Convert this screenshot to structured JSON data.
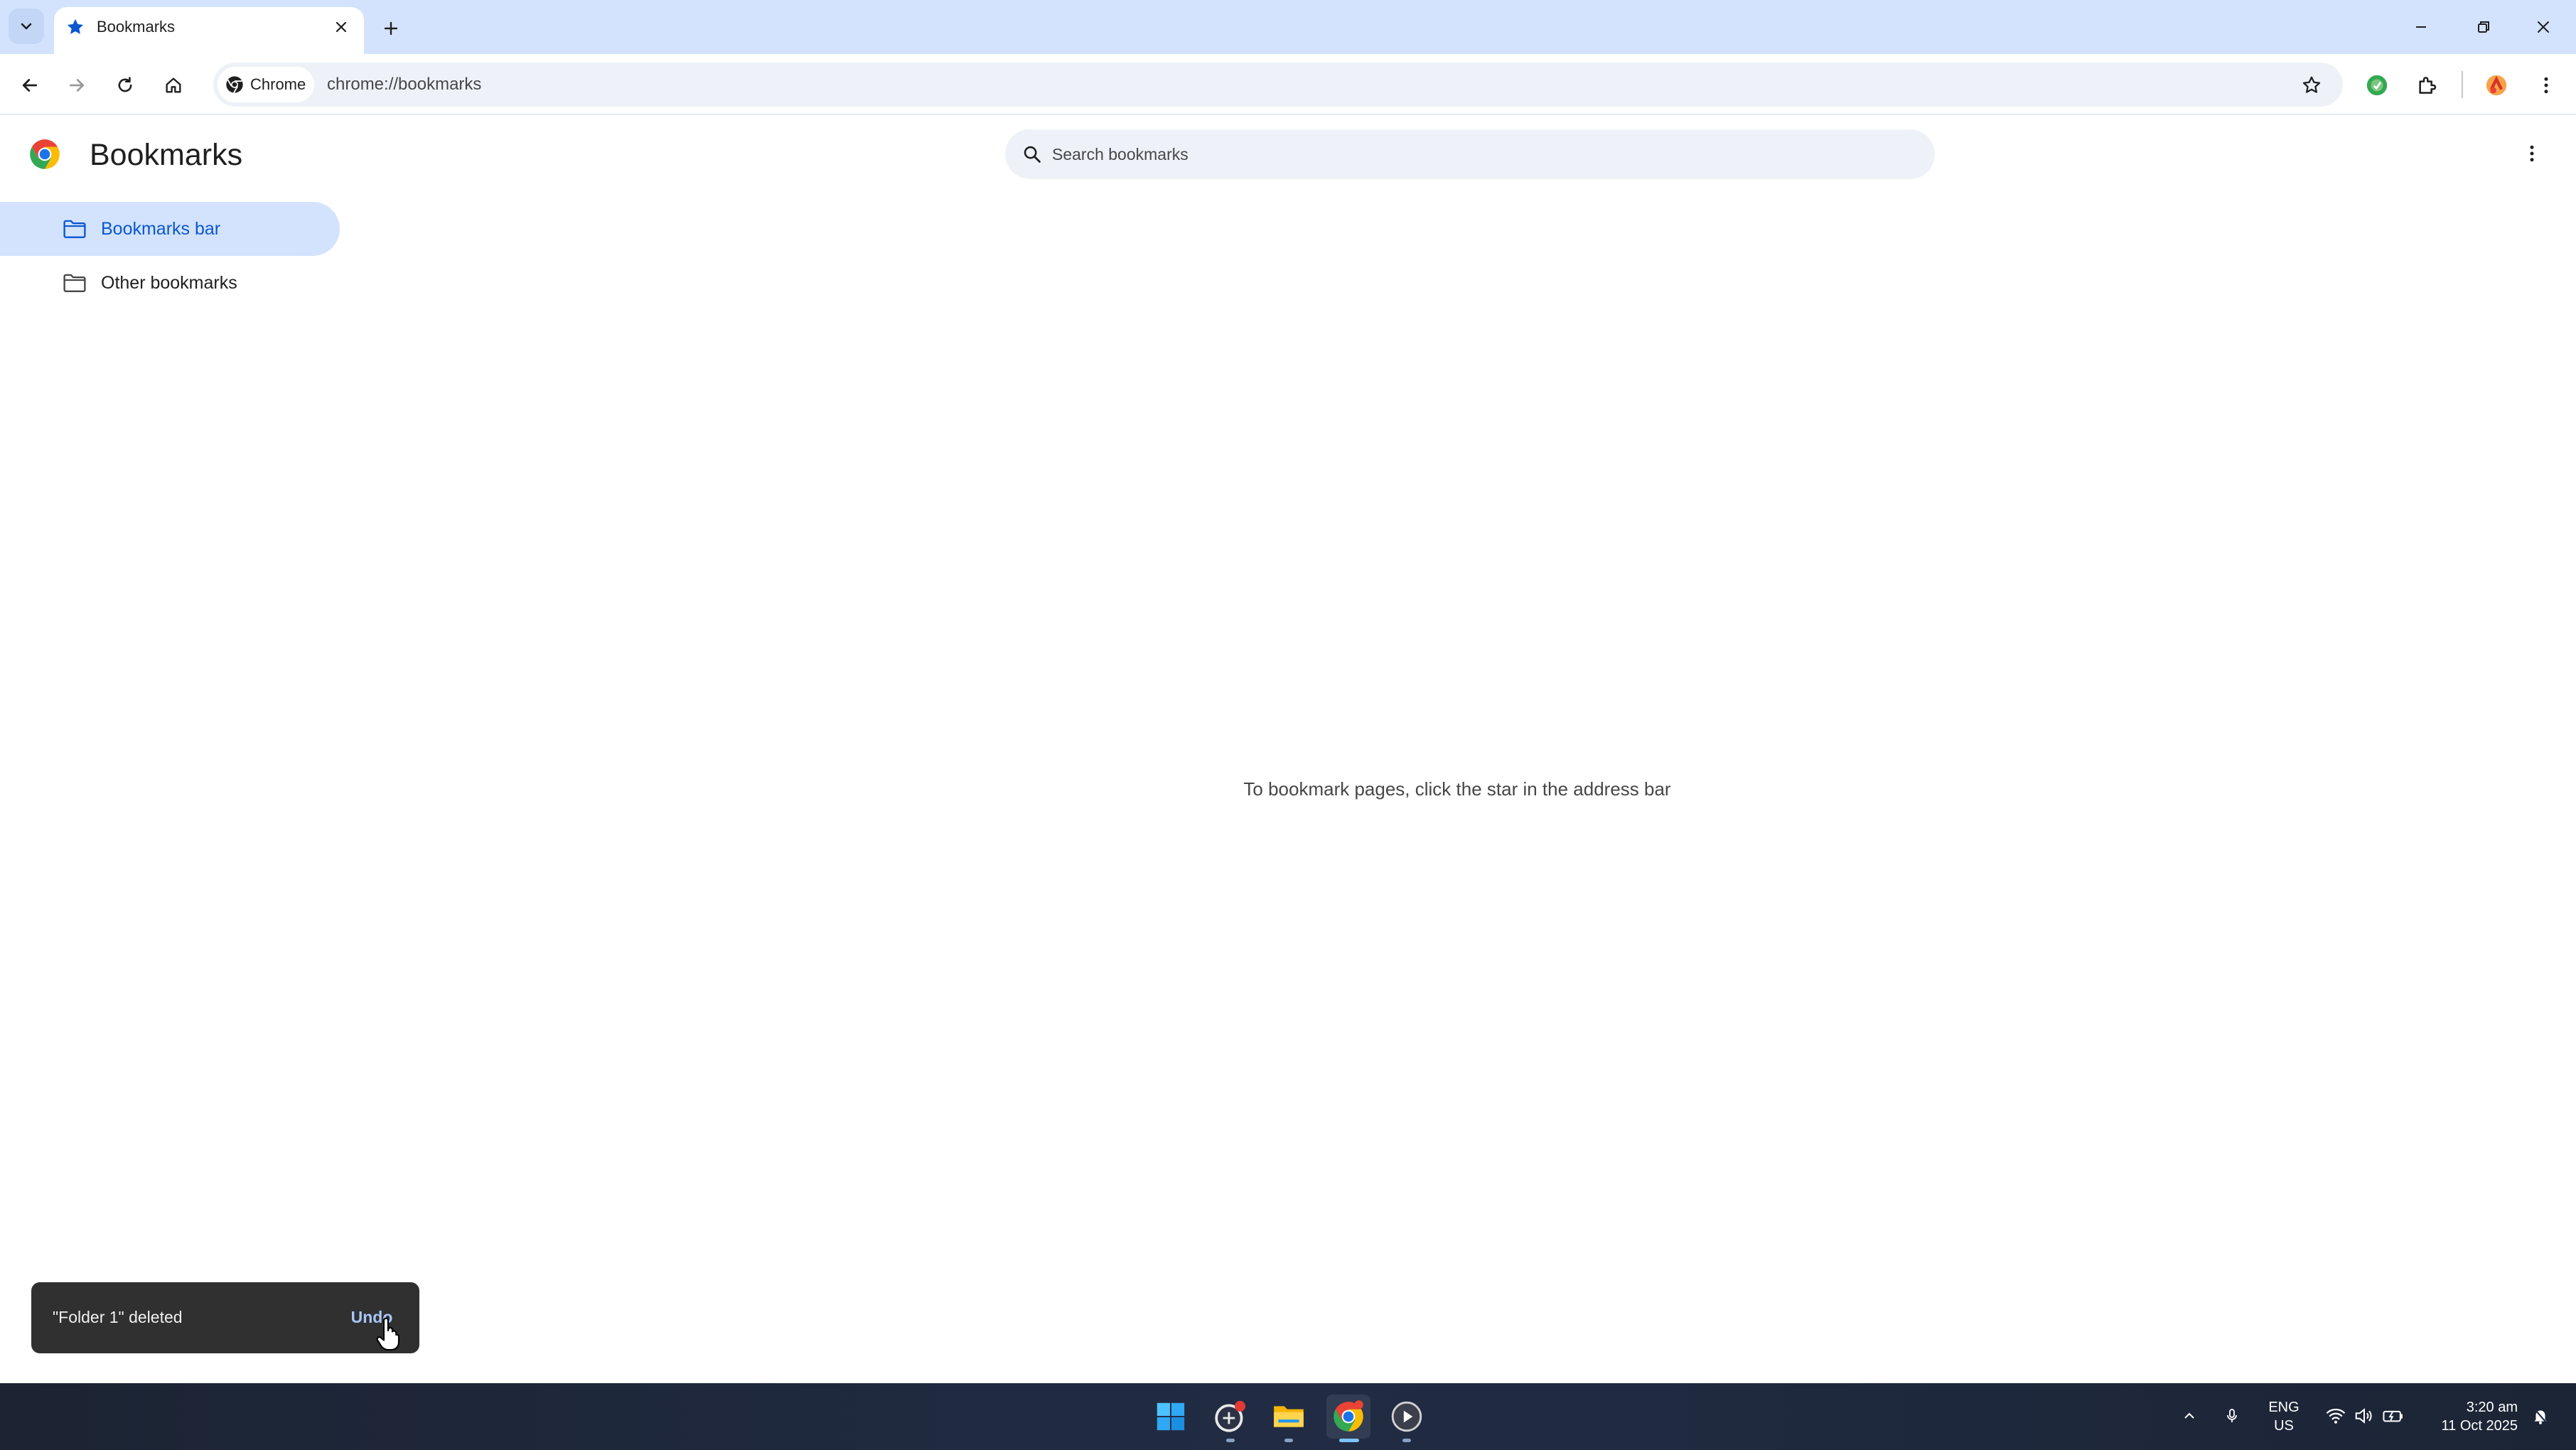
{
  "colors": {
    "tab_strip_bg": "#d3e3fd",
    "accent_blue": "#0b57d0",
    "selected_nav_bg": "#d3e3fd",
    "omnibox_bg": "#eef2f8",
    "toast_bg": "#303030",
    "toast_action": "#a8c7fa",
    "taskbar_bg": "#1f2a3f"
  },
  "browser": {
    "tabs": [
      {
        "title": "Bookmarks",
        "icon": "star-icon",
        "active": true
      }
    ],
    "toolbar": {
      "site_chip_label": "Chrome",
      "url": "chrome://bookmarks",
      "icons": [
        "back-arrow-icon",
        "forward-arrow-icon",
        "reload-icon",
        "home-icon",
        "bookmark-star-icon",
        "green-extension-icon",
        "extensions-puzzle-icon",
        "profile-avatar-icon",
        "more-vertical-icon"
      ]
    }
  },
  "bookmarks_page": {
    "title": "Bookmarks",
    "search": {
      "placeholder": "Search bookmarks",
      "value": ""
    },
    "sidebar": {
      "items": [
        {
          "label": "Bookmarks bar",
          "icon": "folder-icon",
          "selected": true
        },
        {
          "label": "Other bookmarks",
          "icon": "folder-icon",
          "selected": false
        }
      ]
    },
    "empty_message": "To bookmark pages, click the star in the address bar"
  },
  "toast": {
    "message": "\"Folder 1\" deleted",
    "action": "Undo"
  },
  "taskbar": {
    "apps": [
      "windows-start-icon",
      "app-with-badge-icon",
      "file-explorer-icon",
      "chrome-icon",
      "media-player-icon"
    ],
    "tray": {
      "language_line1": "ENG",
      "language_line2": "US",
      "time": "3:20 am",
      "date": "11 Oct 2025"
    }
  }
}
